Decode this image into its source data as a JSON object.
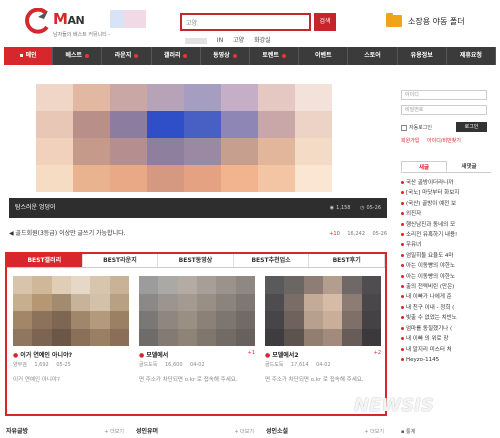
{
  "header": {
    "logo_text": "M",
    "logo_text2": "AN",
    "tagline": "남자들의 베스트 커뮤니티 -",
    "search_value": "고양",
    "search_button": "검색",
    "popular": [
      "IN",
      "고양",
      "화강실"
    ],
    "folder_label": "소장용 야동 폴더"
  },
  "nav": {
    "items": [
      "메인",
      "베스트",
      "라운지",
      "갤러리",
      "동영상",
      "토렌트",
      "이벤트",
      "스토어",
      "유용정보",
      "제휴요청"
    ],
    "active": "메인"
  },
  "hero": {
    "caption": "탐스러운 엉덩이",
    "views": "1,158",
    "date": "05-26"
  },
  "notice": {
    "text": "골드회원(3등급) 이상만 글쓰기 가능합니다.",
    "plus": "+10",
    "count": "16,242",
    "date": "05-26"
  },
  "best": {
    "tabs": [
      "BEST갤러리",
      "BEST라운지",
      "BEST동영상",
      "BEST추천업소",
      "BEST후기"
    ],
    "active_tab": "BEST갤러리",
    "cards": [
      {
        "title": "이거 연예인 아니야?",
        "count": "",
        "author": "양부검",
        "views": "1,692",
        "date": "05-25",
        "desc": "이거 연예인 아니야?"
      },
      {
        "title": "모델에서",
        "count": "+1",
        "author": "골드도둑",
        "views": "16,600",
        "date": "04-02",
        "desc": "면 주소가 차단되면 o.kr 로 접속해 주세요."
      },
      {
        "title": "모델에서2",
        "count": "+2",
        "author": "골드도둑",
        "views": "17,614",
        "date": "04-02",
        "desc": "면 주소가 차단되면 o.kr 로 접속해 주세요."
      }
    ]
  },
  "bottom": {
    "cats": [
      {
        "label": "자유글방",
        "more": "+ 더보기"
      },
      {
        "label": "성인유머",
        "more": "+ 더보기"
      },
      {
        "label": "성인소설",
        "more": "+ 더보기"
      }
    ]
  },
  "sidebar": {
    "id_placeholder": "아이디",
    "pw_placeholder": "비밀번호",
    "auto_login": "자동로그인",
    "login_button": "로그인",
    "links": [
      "회원가입",
      "아이디/비번찾기"
    ],
    "tabs": [
      "새글",
      "새댓글"
    ],
    "active_tab": "새글",
    "posts": [
      {
        "text": "국산 골방이더라니까",
        "count": ""
      },
      {
        "text": "[국노] 마닷부터 화보지",
        "count": ""
      },
      {
        "text": "(국산) 골방이 예전 보",
        "count": ""
      },
      {
        "text": "외진자",
        "count": ""
      },
      {
        "text": "행신남진과 동네의 모",
        "count": ""
      },
      {
        "text": "소리전 유혹하기 내용!",
        "count": ""
      },
      {
        "text": "우유녀",
        "count": ""
      },
      {
        "text": "엄밀히둘 요율도 4마",
        "count": ""
      },
      {
        "text": "아는 이동빵의 야한노",
        "count": ""
      },
      {
        "text": "아는 이동빵의 야한노",
        "count": ""
      },
      {
        "text": "출의 전력비린 (만은)",
        "count": ""
      },
      {
        "text": "내 이빠가 나에게 준",
        "count": ""
      },
      {
        "text": "내 친구 이내 - 정희 (",
        "count": ""
      },
      {
        "text": "빛출 수 없었는 치빈노",
        "count": ""
      },
      {
        "text": "엄마를 동질했기나 (",
        "count": ""
      },
      {
        "text": "내 이빠 의 위로 장",
        "count": ""
      },
      {
        "text": "내 알지리 미스터 처",
        "count": ""
      },
      {
        "text": "Heyzo-1145",
        "count": ""
      }
    ],
    "bottom_label": "통계"
  },
  "watermark": "NEWSIS",
  "colors": {
    "accent": "#d7262c",
    "nav_bg": "#3b3b3b"
  }
}
